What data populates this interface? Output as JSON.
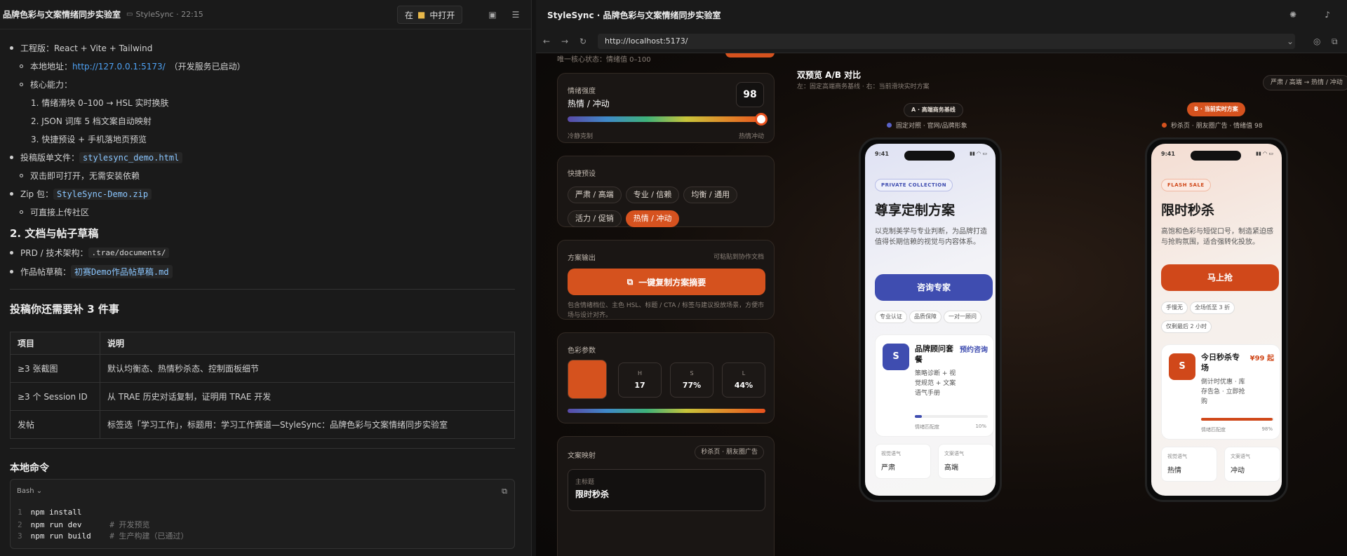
{
  "left": {
    "title": "品牌色彩与文案情绪同步实验室",
    "subtitle": "StyleSync · 22:15",
    "open_prefix": "在",
    "open_label": "中打开",
    "stack_label": "工程版：React + Vite + Tailwind",
    "local_prefix": "本地地址：",
    "local_url": "http://127.0.0.1:5173/",
    "local_note": "（开发服务已启动）",
    "core_label": "核心能力：",
    "core_items": [
      "1. 情绪滑块 0–100 → HSL 实时换肤",
      "2. JSON 词库 5 档文案自动映射",
      "3. 快捷预设 + 手机落地页预览"
    ],
    "single_prefix": "投稿版单文件：",
    "single_file": "stylesync_demo.html",
    "single_note": "双击即可打开，无需安装依赖",
    "zip_prefix": "Zip 包：",
    "zip_file": "StyleSync-Demo.zip",
    "zip_note": "可直接上传社区",
    "h_docs": "2. 文档与帖子草稿",
    "prd_prefix": "PRD / 技术架构：",
    "prd_path": ".trae/documents/",
    "draft_prefix": "作品帖草稿：",
    "draft_file": "初赛Demo作品帖草稿.md",
    "h_need": "投稿你还需要补 3 件事",
    "table": {
      "headers": [
        "项目",
        "说明"
      ],
      "rows": [
        [
          "≥3 张截图",
          "默认均衡态、热情秒杀态、控制面板细节"
        ],
        [
          "≥3 个 Session ID",
          "从 TRAE 历史对话复制，证明用 TRAE 开发"
        ],
        [
          "发帖",
          "标签选「学习工作」，标题用：学习工作赛道—StyleSync：品牌色彩与文案情绪同步实验室"
        ]
      ]
    },
    "h_cmd": "本地命令",
    "bash_label": "Bash",
    "bash_lines": [
      {
        "n": "1",
        "cmd": "npm install",
        "c": ""
      },
      {
        "n": "2",
        "cmd": "npm run dev      ",
        "c": "# 开发预览"
      },
      {
        "n": "3",
        "cmd": "npm run build    ",
        "c": "# 生产构建（已通过）"
      }
    ]
  },
  "right": {
    "title": "StyleSync · 品牌色彩与文案情绪同步实验室",
    "url": "http://localhost:5173/",
    "top_note": "唯一核心状态：情绪值 0–100",
    "intensity": {
      "label": "情绪强度",
      "mood": "热情 / 冲动",
      "value": "98",
      "min": "冷静克制",
      "max": "热情冲动",
      "level": 0.98
    },
    "presets": {
      "label": "快捷预设",
      "items": [
        "严肃 / 高端",
        "专业 / 信赖",
        "均衡 / 通用",
        "活力 / 促销",
        "热情 / 冲动"
      ],
      "active": 4
    },
    "output": {
      "label": "方案输出",
      "hint": "可粘贴到协作文档",
      "button": "一键复制方案摘要",
      "desc": "包含情绪档位、主色 HSL、标题 / CTA / 标签与建议投放场景，方便市场与设计对齐。"
    },
    "color": {
      "label": "色彩参数",
      "h_label": "H",
      "h": "17",
      "s_label": "S",
      "s": "77%",
      "l_label": "L",
      "l": "44%",
      "swatch": "#d5521e"
    },
    "copy": {
      "label": "文案映射",
      "scene": "秒杀页 · 朋友圈广告",
      "field": "主标题",
      "headline": "限时秒杀"
    },
    "ab": {
      "title": "双预览 A/B 对比",
      "sub": "左：固定高端商务基线 · 右：当前滑块实时方案",
      "flow": "严肃 / 高端 → 热情 / 冲动",
      "a_tag": "A · 高端商务基线",
      "a_note": "固定对照 · 官网/品牌形象",
      "b_tag": "B · 当前实时方案",
      "b_note": "秒杀页 · 朋友圈广告 · 情绪值 98"
    },
    "phoneA": {
      "time": "9:41",
      "tag": "PRIVATE COLLECTION",
      "title": "尊享定制方案",
      "desc": "以克制美学与专业判断，为品牌打造值得长期信赖的视觉与内容体系。",
      "cta": "咨询专家",
      "chips": [
        "专业认证",
        "品质保障",
        "一对一顾问"
      ],
      "avatar": "S",
      "card_title": "品牌顾问套餐",
      "card_action": "预约咨询",
      "card_desc": "策略诊断 + 视觉规范 + 文案语气手册",
      "meter_label": "情绪匹配度",
      "meter_val": "10%",
      "meter": 0.1,
      "m1k": "视觉语气",
      "m1v": "严肃",
      "m2k": "文案语气",
      "m2v": "高端",
      "accent": "#3f4db0"
    },
    "phoneB": {
      "time": "9:41",
      "tag": "FLASH SALE",
      "title": "限时秒杀",
      "desc": "高饱和色彩与短促口号，制造紧迫感与抢购氛围，适合强转化投放。",
      "cta": "马上抢",
      "chips": [
        "手慢无",
        "全场低至 3 折",
        "仅剩最后 2 小时"
      ],
      "avatar": "S",
      "card_title": "今日秒杀专场",
      "card_action": "¥99 起",
      "card_desc": "倒计时优惠 · 库存告急 · 立即抢购",
      "meter_label": "情绪匹配度",
      "meter_val": "98%",
      "meter": 0.98,
      "m1k": "视觉语气",
      "m1v": "热情",
      "m2k": "文案语气",
      "m2v": "冲动",
      "accent": "#d0481a"
    }
  }
}
